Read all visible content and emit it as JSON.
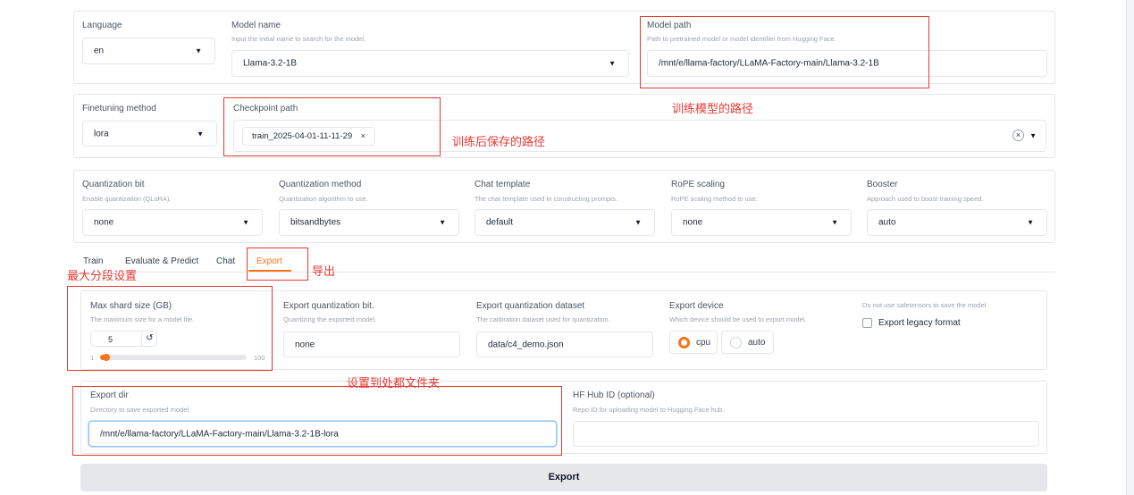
{
  "top": {
    "language": {
      "label": "Language",
      "value": "en"
    },
    "model_name": {
      "label": "Model name",
      "hint": "Input the initial name to search for the model.",
      "value": "Llama-3.2-1B"
    },
    "model_path": {
      "label": "Model path",
      "hint": "Path to pretrained model or model identifier from Hugging Face.",
      "value": "/mnt/e/llama-factory/LLaMA-Factory-main/Llama-3.2-1B"
    }
  },
  "row2": {
    "finetuning": {
      "label": "Finetuning method",
      "value": "lora"
    },
    "checkpoint": {
      "label": "Checkpoint path",
      "chip": "train_2025-04-01-11-11-29",
      "chip_close": "×",
      "clear": "×"
    }
  },
  "row3": {
    "quant_bit": {
      "label": "Quantization bit",
      "hint": "Enable quantization (QLoRA).",
      "value": "none"
    },
    "quant_method": {
      "label": "Quantization method",
      "hint": "Quantization algorithm to use.",
      "value": "bitsandbytes"
    },
    "chat_template": {
      "label": "Chat template",
      "hint": "The chat template used in constructing prompts.",
      "value": "default"
    },
    "rope": {
      "label": "RoPE scaling",
      "hint": "RoPE scaling method to use.",
      "value": "none"
    },
    "booster": {
      "label": "Booster",
      "hint": "Approach used to boost training speed.",
      "value": "auto"
    }
  },
  "tabs": [
    "Train",
    "Evaluate & Predict",
    "Chat",
    "Export"
  ],
  "export": {
    "shard": {
      "label": "Max shard size (GB)",
      "hint": "The maximum size for a model file.",
      "value": "5",
      "reset": "↺",
      "min": "1",
      "max": "100",
      "fraction": 0.04
    },
    "quant_bit": {
      "label": "Export quantization bit.",
      "hint": "Quantizing the exported model.",
      "value": "none"
    },
    "quant_dataset": {
      "label": "Export quantization dataset",
      "hint": "The calibration dataset used for quantization.",
      "value": "data/c4_demo.json"
    },
    "device": {
      "label": "Export device",
      "hint": "Which device should be used to export model.",
      "options": [
        "cpu",
        "auto"
      ],
      "selected": "cpu"
    },
    "legacy": {
      "hint": "Do not use safetensors to save the model.",
      "label": "Export legacy format",
      "checked": false
    },
    "dir": {
      "label": "Export dir",
      "hint": "Directory to save exported model.",
      "value": "/mnt/e/llama-factory/LLaMA-Factory-main/Llama-3.2-1B-lora"
    },
    "hub": {
      "label": "HF Hub ID (optional)",
      "hint": "Repo ID for uploading model to Hugging Face hub.",
      "value": ""
    },
    "button": "Export"
  },
  "annotations": {
    "model_path": "训练模型的路径",
    "checkpoint": "训练后保存的路径",
    "export_tab": "导出",
    "shard": "最大分段设置",
    "dir": "设置到处都文件夹"
  },
  "colors": {
    "accent": "#f97316",
    "annotation": "#e53935",
    "border": "#e5e7eb",
    "button_bg": "#e5e7eb"
  }
}
